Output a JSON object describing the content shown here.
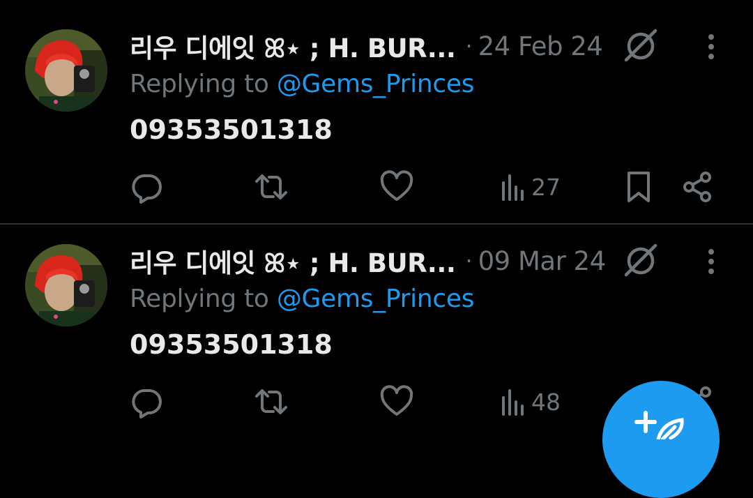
{
  "colors": {
    "background": "#000000",
    "text_primary": "#e7e9ea",
    "text_secondary": "#71767b",
    "accent": "#1d9bf0",
    "divider": "#2f3336"
  },
  "tweets": [
    {
      "author_name": "리우 디에잇 ꕤ⋆ ; H. BUR...",
      "separator": "·",
      "date": "24 Feb 24",
      "reply_prefix": "Replying to ",
      "reply_handle": "@Gems_Princes",
      "text": "09353501318",
      "views": "27",
      "icons": [
        "avatar",
        "grok-icon",
        "more-icon",
        "reply-icon",
        "retweet-icon",
        "like-icon",
        "views-icon",
        "bookmark-icon",
        "share-icon"
      ]
    },
    {
      "author_name": "리우 디에잇 ꕤ⋆ ; H. BUR...",
      "separator": "·",
      "date": "09 Mar 24",
      "reply_prefix": "Replying to ",
      "reply_handle": "@Gems_Princes",
      "text": "09353501318",
      "views": "48",
      "icons": [
        "avatar",
        "grok-icon",
        "more-icon",
        "reply-icon",
        "retweet-icon",
        "like-icon",
        "views-icon",
        "bookmark-icon",
        "share-icon"
      ]
    }
  ],
  "fab": {
    "icon": "compose-post-icon"
  }
}
